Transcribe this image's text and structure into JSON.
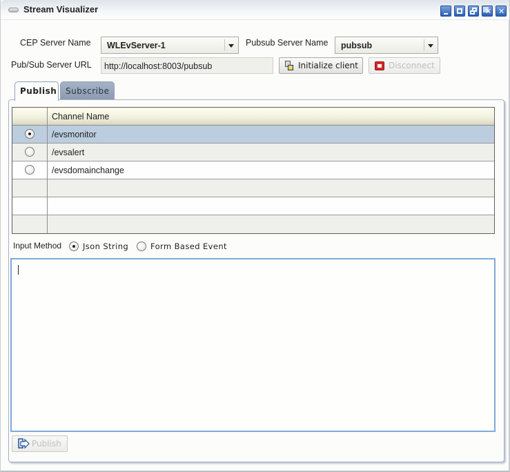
{
  "window": {
    "title": "Stream Visualizer",
    "controls": [
      "minimize",
      "maximize",
      "restore",
      "close-all",
      "close"
    ]
  },
  "form": {
    "cep_server_label": "CEP Server Name",
    "cep_server_value": "WLEvServer-1",
    "pubsub_server_label": "Pubsub Server Name",
    "pubsub_server_value": "pubsub",
    "url_label": "Pub/Sub Server URL",
    "url_value": "http://localhost:8003/pubsub",
    "initialize_label": "Initialize client",
    "disconnect_label": "Disconnect",
    "disconnect_enabled": false
  },
  "tabs": [
    {
      "label": "Publish",
      "active": true
    },
    {
      "label": "Subscribe",
      "active": false
    }
  ],
  "table": {
    "columns": [
      "",
      "Channel Name"
    ],
    "rows": [
      {
        "channel": "/evsmonitor",
        "selected": true
      },
      {
        "channel": "/evsalert",
        "selected": false
      },
      {
        "channel": "/evsdomainchange",
        "selected": false
      },
      {
        "channel": "",
        "selected": null
      },
      {
        "channel": "",
        "selected": null
      },
      {
        "channel": "",
        "selected": null
      }
    ]
  },
  "input_method": {
    "label": "Input Method",
    "options": [
      {
        "label": "Json String",
        "selected": true
      },
      {
        "label": "Form Based Event",
        "selected": false
      }
    ]
  },
  "editor": {
    "value": ""
  },
  "publish": {
    "label": "Publish",
    "enabled": false
  },
  "colors": {
    "selection": "#bccddf",
    "editor_border": "#7fa8de",
    "disconnect_icon": "#d42a2a"
  }
}
